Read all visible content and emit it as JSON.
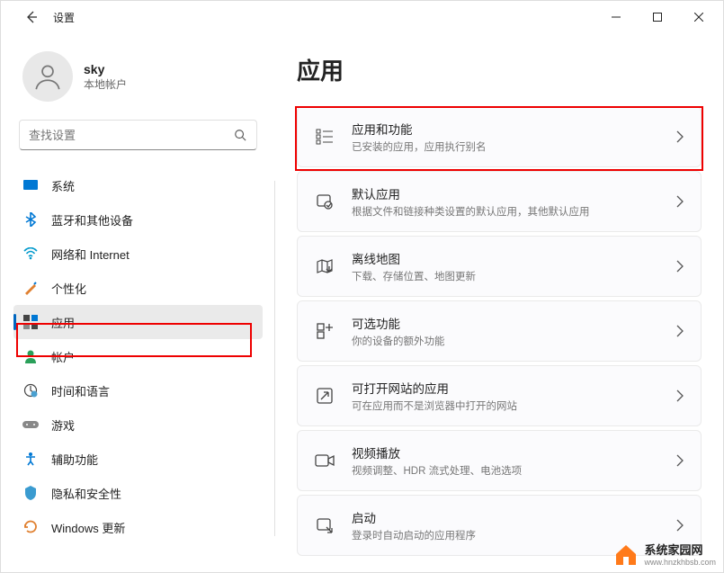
{
  "titlebar": {
    "title": "设置"
  },
  "user": {
    "name": "sky",
    "subtitle": "本地帐户"
  },
  "search": {
    "placeholder": "查找设置"
  },
  "sidebar": {
    "items": [
      {
        "label": "系统"
      },
      {
        "label": "蓝牙和其他设备"
      },
      {
        "label": "网络和 Internet"
      },
      {
        "label": "个性化"
      },
      {
        "label": "应用"
      },
      {
        "label": "帐户"
      },
      {
        "label": "时间和语言"
      },
      {
        "label": "游戏"
      },
      {
        "label": "辅助功能"
      },
      {
        "label": "隐私和安全性"
      },
      {
        "label": "Windows 更新"
      }
    ]
  },
  "main": {
    "title": "应用",
    "cards": [
      {
        "title": "应用和功能",
        "sub": "已安装的应用，应用执行别名"
      },
      {
        "title": "默认应用",
        "sub": "根据文件和链接种类设置的默认应用，其他默认应用"
      },
      {
        "title": "离线地图",
        "sub": "下载、存储位置、地图更新"
      },
      {
        "title": "可选功能",
        "sub": "你的设备的额外功能"
      },
      {
        "title": "可打开网站的应用",
        "sub": "可在应用而不是浏览器中打开的网站"
      },
      {
        "title": "视频播放",
        "sub": "视频调整、HDR 流式处理、电池选项"
      },
      {
        "title": "启动",
        "sub": "登录时自动启动的应用程序"
      }
    ]
  },
  "watermark": {
    "line1": "系统家园网",
    "line2": "www.hnzkhbsb.com"
  }
}
